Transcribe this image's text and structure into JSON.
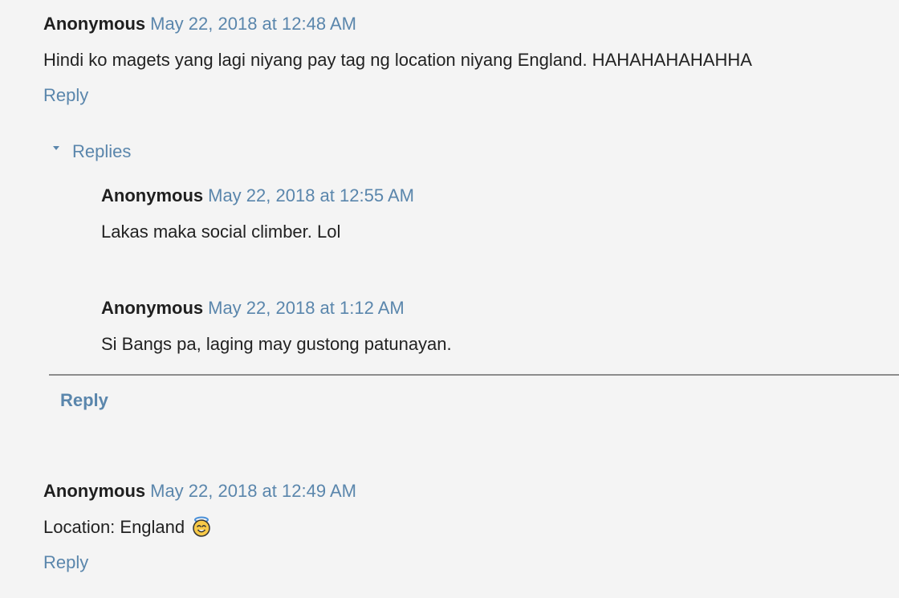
{
  "comments": [
    {
      "author": "Anonymous",
      "timestamp": "May 22, 2018 at 12:48 AM",
      "text": "Hindi ko magets yang lagi niyang pay tag ng location niyang England. HAHAHAHAHAHHA",
      "reply_label": "Reply",
      "replies_toggle_label": "Replies",
      "replies": [
        {
          "author": "Anonymous",
          "timestamp": "May 22, 2018 at 12:55 AM",
          "text": "Lakas maka social climber. Lol"
        },
        {
          "author": "Anonymous",
          "timestamp": "May 22, 2018 at 1:12 AM",
          "text": "Si Bangs pa, laging may gustong patunayan."
        }
      ],
      "thread_reply_label": "Reply"
    },
    {
      "author": "Anonymous",
      "timestamp": "May 22, 2018 at 12:49 AM",
      "text": "Location: England",
      "emoji": "smiling-face-with-halo-icon",
      "reply_label": "Reply"
    }
  ],
  "colors": {
    "background": "#f4f4f4",
    "link": "#5a86ac",
    "text": "#222222",
    "divider": "#8c8c8c"
  }
}
